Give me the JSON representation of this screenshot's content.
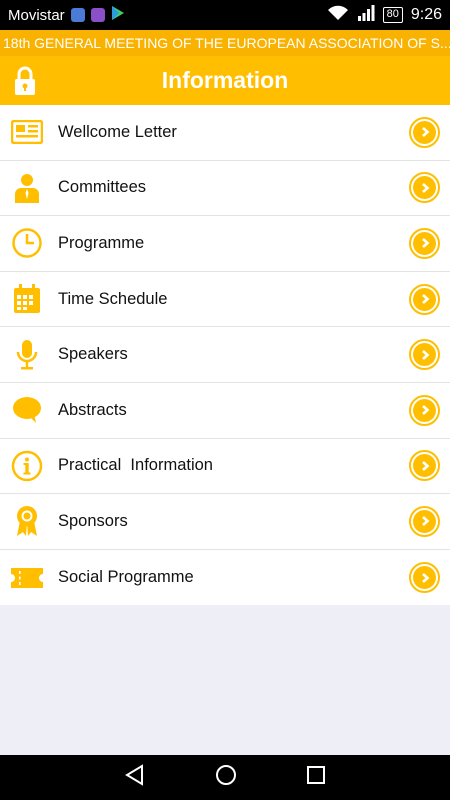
{
  "status_bar": {
    "carrier": "Movistar",
    "battery": "80",
    "time": "9:26",
    "app_icons": [
      "shield-app-icon",
      "gallery-app-icon",
      "play-store-icon"
    ]
  },
  "marquee_text": "18th GENERAL MEETING OF THE EUROPEAN ASSOCIATION OF S...",
  "header": {
    "title": "Information"
  },
  "colors": {
    "accent": "#ffbf00",
    "marquee": "#f9b200",
    "background": "#eeeef6"
  },
  "menu": [
    {
      "label": "Wellcome Letter",
      "icon": "newspaper-icon"
    },
    {
      "label": "Committees",
      "icon": "person-icon"
    },
    {
      "label": "Programme",
      "icon": "clock-icon"
    },
    {
      "label": "Time Schedule",
      "icon": "calendar-icon"
    },
    {
      "label": "Speakers",
      "icon": "microphone-icon"
    },
    {
      "label": "Abstracts",
      "icon": "speech-bubble-icon"
    },
    {
      "label": "Practical  Information",
      "icon": "info-icon"
    },
    {
      "label": "Sponsors",
      "icon": "award-ribbon-icon"
    },
    {
      "label": "Social Programme",
      "icon": "ticket-icon"
    }
  ],
  "nav_bar": [
    "back-icon",
    "home-icon",
    "recents-icon"
  ]
}
